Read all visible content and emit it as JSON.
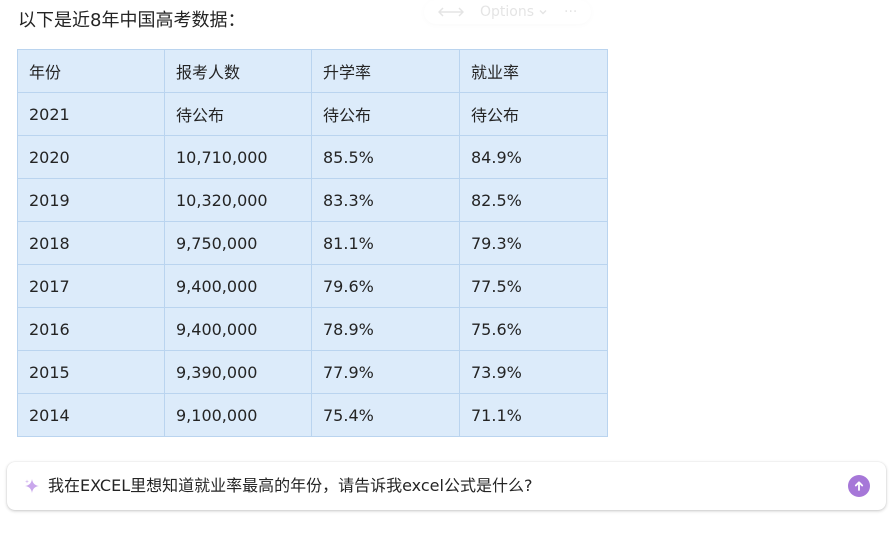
{
  "message": {
    "intro": "以下是近8年中国高考数据："
  },
  "toolbar": {
    "swap_icon": "arrows-left-right-icon",
    "options_label": "Options",
    "more_label": "···"
  },
  "table": {
    "headers": [
      "年份",
      "报考人数",
      "升学率",
      "就业率"
    ],
    "rows": [
      [
        "2021",
        "待公布",
        "待公布",
        "待公布"
      ],
      [
        "2020",
        "10,710,000",
        "85.5%",
        "84.9%"
      ],
      [
        "2019",
        "10,320,000",
        "83.3%",
        "82.5%"
      ],
      [
        "2018",
        "9,750,000",
        "81.1%",
        "79.3%"
      ],
      [
        "2017",
        "9,400,000",
        "79.6%",
        "77.5%"
      ],
      [
        "2016",
        "9,400,000",
        "78.9%",
        "75.6%"
      ],
      [
        "2015",
        "9,390,000",
        "77.9%",
        "73.9%"
      ],
      [
        "2014",
        "9,100,000",
        "75.4%",
        "71.1%"
      ]
    ]
  },
  "composer": {
    "sparkle_icon": "sparkle-icon",
    "prompt": "我在EXCEL里想知道就业率最高的年份，请告诉我excel公式是什么?",
    "send_icon": "arrow-up-icon",
    "accent_color": "#a677d8"
  },
  "colors": {
    "table_bg": "#dcebfa",
    "table_border": "#bad4ef"
  }
}
